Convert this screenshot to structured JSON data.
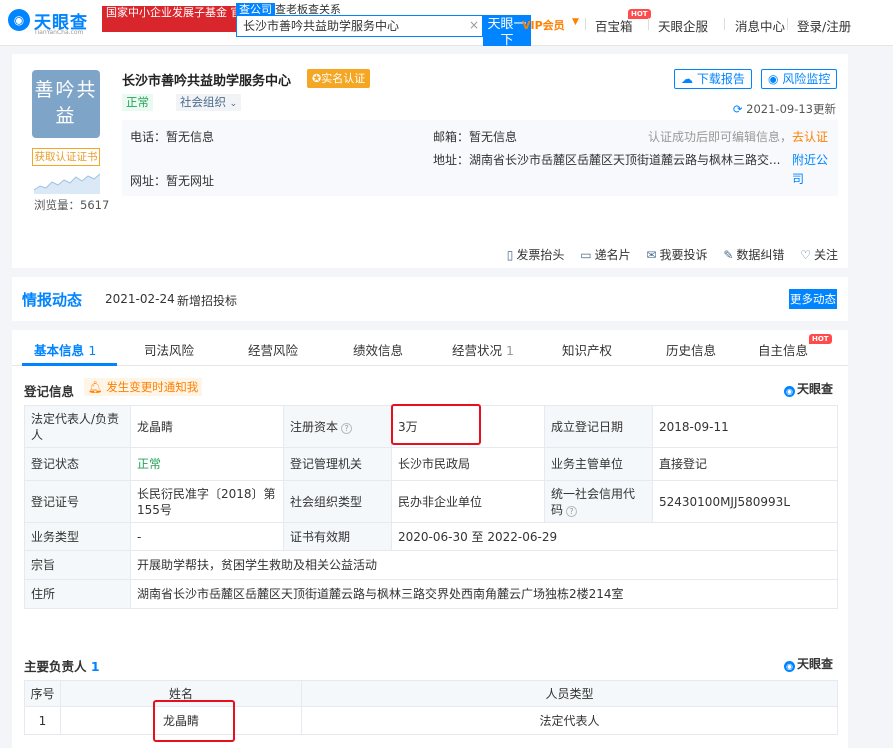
{
  "header": {
    "logo_main": "天眼查",
    "logo_sub": "TianYanCha.com",
    "promo": "国家中小企业发展子基金 官方备案企业征信",
    "search_tabs": [
      "查公司",
      "查老板查关系"
    ],
    "search_value": "长沙市善吟共益助学服务中心",
    "search_button": "天眼一下",
    "vip": "VIP会员",
    "nav": [
      "百宝箱",
      "天眼企服",
      "消息中心",
      "登录/注册"
    ],
    "hot": "HOT",
    "colors": {
      "brand": "#0084ff",
      "promo": "#d8262c",
      "vip": "#ff7f00"
    }
  },
  "company": {
    "logo_text": "善吟共益",
    "get_cert": "获取认证证书",
    "views": "浏览量：5617",
    "name": "长沙市善吟共益助学服务中心",
    "realname": "实名认证",
    "status": "正常",
    "type": "社会组织",
    "download_btn": "下载报告",
    "monitor_btn": "风险监控",
    "updated": "2021-09-13更新",
    "phone": "电话：暂无信息",
    "email": "邮箱：暂无信息",
    "auth_hint": "认证成功后即可编辑信息，",
    "auth_link": "去认证",
    "website": "网址：暂无网址",
    "address": "地址：湖南省长沙市岳麓区岳麓区天顶街道麓云路与枫林三路交...",
    "nearby": "附近公司",
    "tools": [
      "发票抬头",
      "递名片",
      "我要投诉",
      "数据纠错",
      "关注"
    ]
  },
  "intel": {
    "title": "情报动态",
    "date": "2021-02-24",
    "text": "新增招投标",
    "more": "更多动态"
  },
  "tabs": [
    {
      "label": "基本信息",
      "count": "1"
    },
    {
      "label": "司法风险",
      "count": ""
    },
    {
      "label": "经营风险",
      "count": ""
    },
    {
      "label": "绩效信息",
      "count": ""
    },
    {
      "label": "经营状况",
      "count": "1"
    },
    {
      "label": "知识产权",
      "count": ""
    },
    {
      "label": "历史信息",
      "count": ""
    },
    {
      "label": "自主信息",
      "count": ""
    }
  ],
  "registration": {
    "title": "登记信息",
    "notify": "发生变更时通知我",
    "brand": "天眼查",
    "rows": [
      {
        "k1": "法定代表人/负责人",
        "v1": "龙晶睛",
        "k2": "注册资本",
        "v2": "3万",
        "k3": "成立登记日期",
        "v3": "2018-09-11"
      },
      {
        "k1": "登记状态",
        "v1": "正常",
        "k2": "登记管理机关",
        "v2": "长沙市民政局",
        "k3": "业务主管单位",
        "v3": "直接登记"
      },
      {
        "k1": "登记证号",
        "v1": "长民衍民准字〔2018〕第155号",
        "k2": "社会组织类型",
        "v2": "民办非企业单位",
        "k3": "统一社会信用代码",
        "v3": "52430100MJJ580993L"
      },
      {
        "k1": "业务类型",
        "v1": "-",
        "k2": "证书有效期",
        "v2": "2020-06-30 至 2022-06-29"
      }
    ],
    "purpose_label": "宗旨",
    "purpose": "开展助学帮扶，贫困学生救助及相关公益活动",
    "address_label": "住所",
    "address": "湖南省长沙市岳麓区岳麓区天顶街道麓云路与枫林三路交界处西南角麓云广场独栋2楼214室"
  },
  "people": {
    "title": "主要负责人",
    "count": "1",
    "brand": "天眼查",
    "headers": [
      "序号",
      "姓名",
      "人员类型"
    ],
    "rows": [
      {
        "no": "1",
        "name": "龙晶睛",
        "role": "法定代表人"
      }
    ]
  }
}
